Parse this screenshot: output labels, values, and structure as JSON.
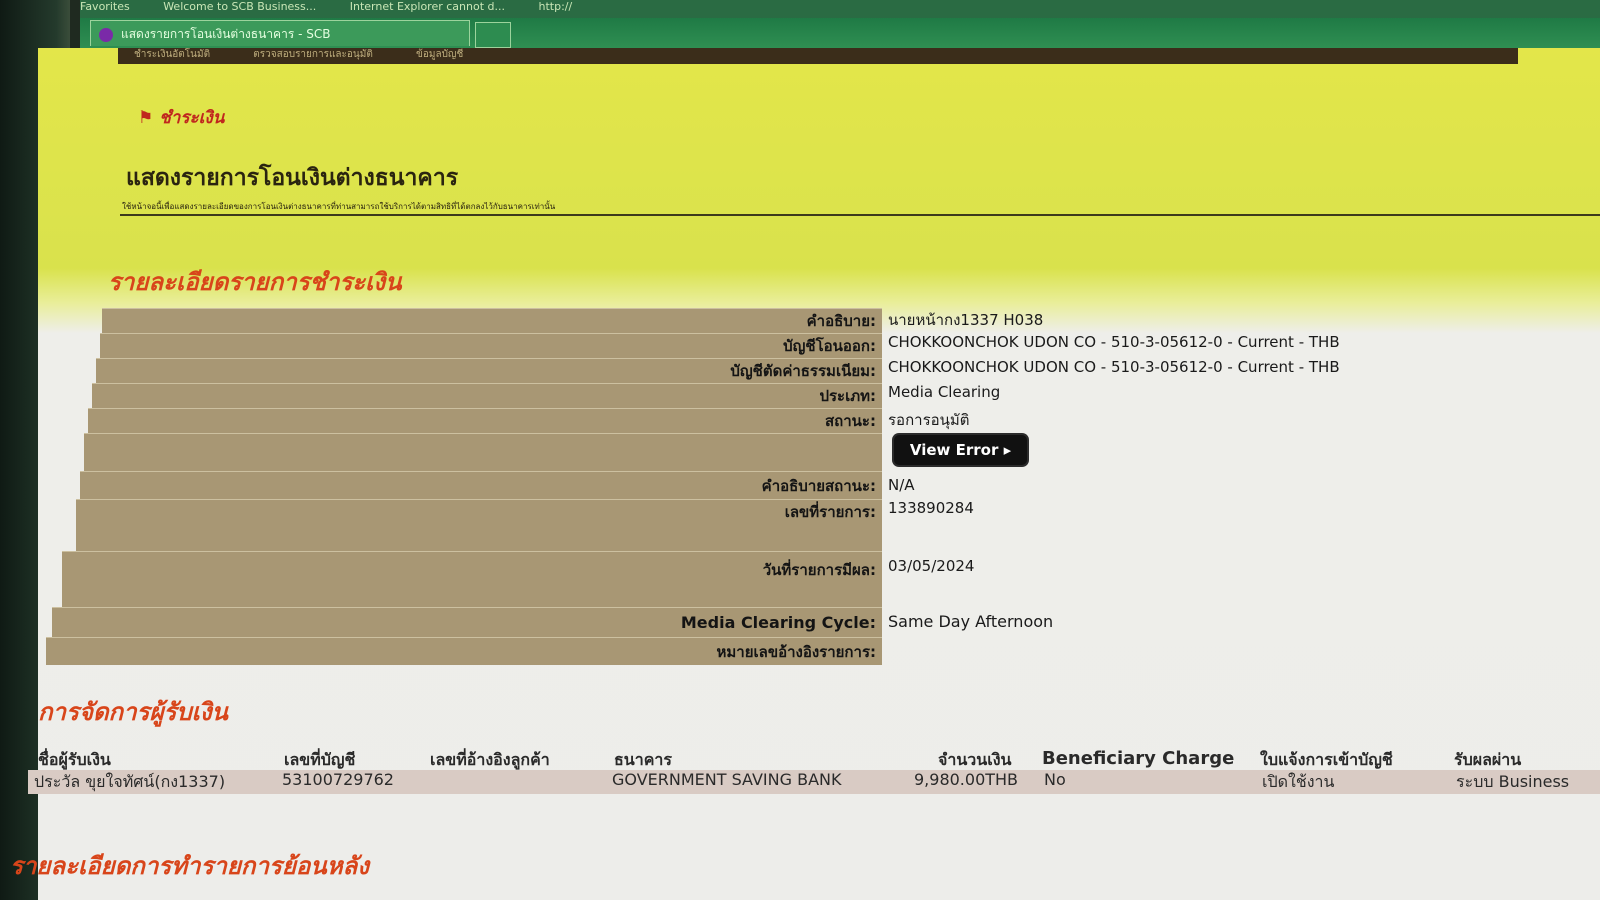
{
  "browser": {
    "favorites": [
      "Favorites",
      "Welcome to SCB Business...",
      "Internet Explorer cannot d...",
      "http://"
    ],
    "tab_title": "แสดงรายการโอนเงินต่างธนาคาร - SCB"
  },
  "nav": [
    "ชำระเงินอัตโนมัติ",
    "ตรวจสอบรายการและอนุมัติ",
    "ข้อมูลบัญชี"
  ],
  "breadcrumb": "ชำระเงิน",
  "page_title": "แสดงรายการโอนเงินต่างธนาคาร",
  "page_subtitle": "ใช้หน้าจอนี้เพื่อแสดงรายละเอียดของการโอนเงินต่างธนาคารที่ท่านสามารถใช้บริการได้ตามสิทธิที่ได้ตกลงไว้กับธนาคารเท่านั้น",
  "detail_section_title": "รายละเอียดรายการชำระเงิน",
  "details": {
    "description_label": "คำอธิบาย:",
    "description_value": "นายหน้ากง1337 H038",
    "debit_account_label": "บัญชีโอนออก:",
    "debit_account_value": "CHOKKOONCHOK UDON CO - 510-3-05612-0 - Current - THB",
    "fee_account_label": "บัญชีตัดค่าธรรมเนียม:",
    "fee_account_value": "CHOKKOONCHOK UDON CO - 510-3-05612-0 - Current - THB",
    "type_label": "ประเภท:",
    "type_value": "Media Clearing",
    "status_label": "สถานะ:",
    "status_value": "รอการอนุมัติ",
    "view_error_label": "View Error ▸",
    "status_desc_label": "คำอธิบายสถานะ:",
    "status_desc_value": "N/A",
    "txn_no_label": "เลขที่รายการ:",
    "txn_no_value": "133890284",
    "effective_date_label": "วันที่รายการมีผล:",
    "effective_date_value": "03/05/2024",
    "cycle_label": "Media Clearing Cycle:",
    "cycle_value": "Same Day Afternoon",
    "reference_label": "หมายเลขอ้างอิงรายการ:",
    "reference_value": ""
  },
  "payee_section_title": "การจัดการผู้รับเงิน",
  "payee_table": {
    "headers": [
      "ชื่อผู้รับเงิน",
      "เลขที่บัญชี",
      "เลขที่อ้างอิงลูกค้า",
      "ธนาคาร",
      "จำนวนเงิน",
      "Beneficiary Charge",
      "ใบแจ้งการเข้าบัญชี",
      "รับผลผ่าน"
    ],
    "rows": [
      [
        "ประวัล ขุยใจทัศน์(กง1337)",
        "53100729762",
        "",
        "GOVERNMENT SAVING BANK",
        "9,980.00THB",
        "No",
        "เปิดใช้งาน",
        "ระบบ Business"
      ]
    ]
  },
  "history_section_title": "รายละเอียดการทำรายการย้อนหลัง"
}
